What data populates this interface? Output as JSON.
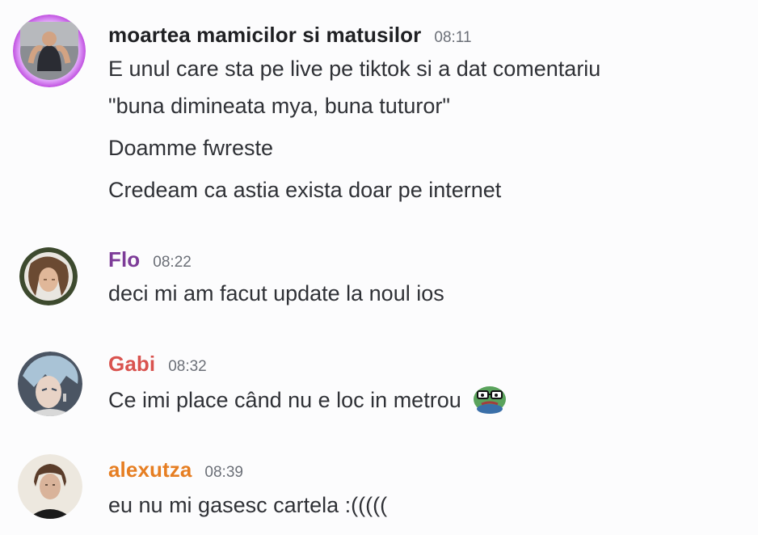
{
  "colors": {
    "background": "#fcfcfd",
    "text": "#2f3136",
    "timestamp": "#6b6f77"
  },
  "messages": [
    {
      "author": "moartea mamicilor si matusilor",
      "author_color": "#1f2023",
      "time": "08:11",
      "avatar_icon": "gym-selfie-avatar",
      "lines": [
        "E unul care sta pe live pe tiktok si a dat comentariu",
        "\"buna dimineata mya, buna tuturor\"",
        "Doamme fwreste",
        "Credeam ca astia exista doar pe internet"
      ]
    },
    {
      "author": "Flo",
      "author_color": "#7d3c98",
      "time": "08:22",
      "avatar_icon": "portrait-avatar",
      "lines": [
        "deci mi am facut update la noul ios"
      ]
    },
    {
      "author": "Gabi",
      "author_color": "#d9534f",
      "time": "08:32",
      "avatar_icon": "anime-character-avatar",
      "lines": [
        "Ce imi place când nu e loc in metrou"
      ],
      "emoji": "pepe-glasses-emoji"
    },
    {
      "author": "alexutza",
      "author_color": "#e67e22",
      "time": "08:39",
      "avatar_icon": "portrait-avatar",
      "lines": [
        "eu nu mi gasesc cartela :((((("
      ]
    }
  ]
}
